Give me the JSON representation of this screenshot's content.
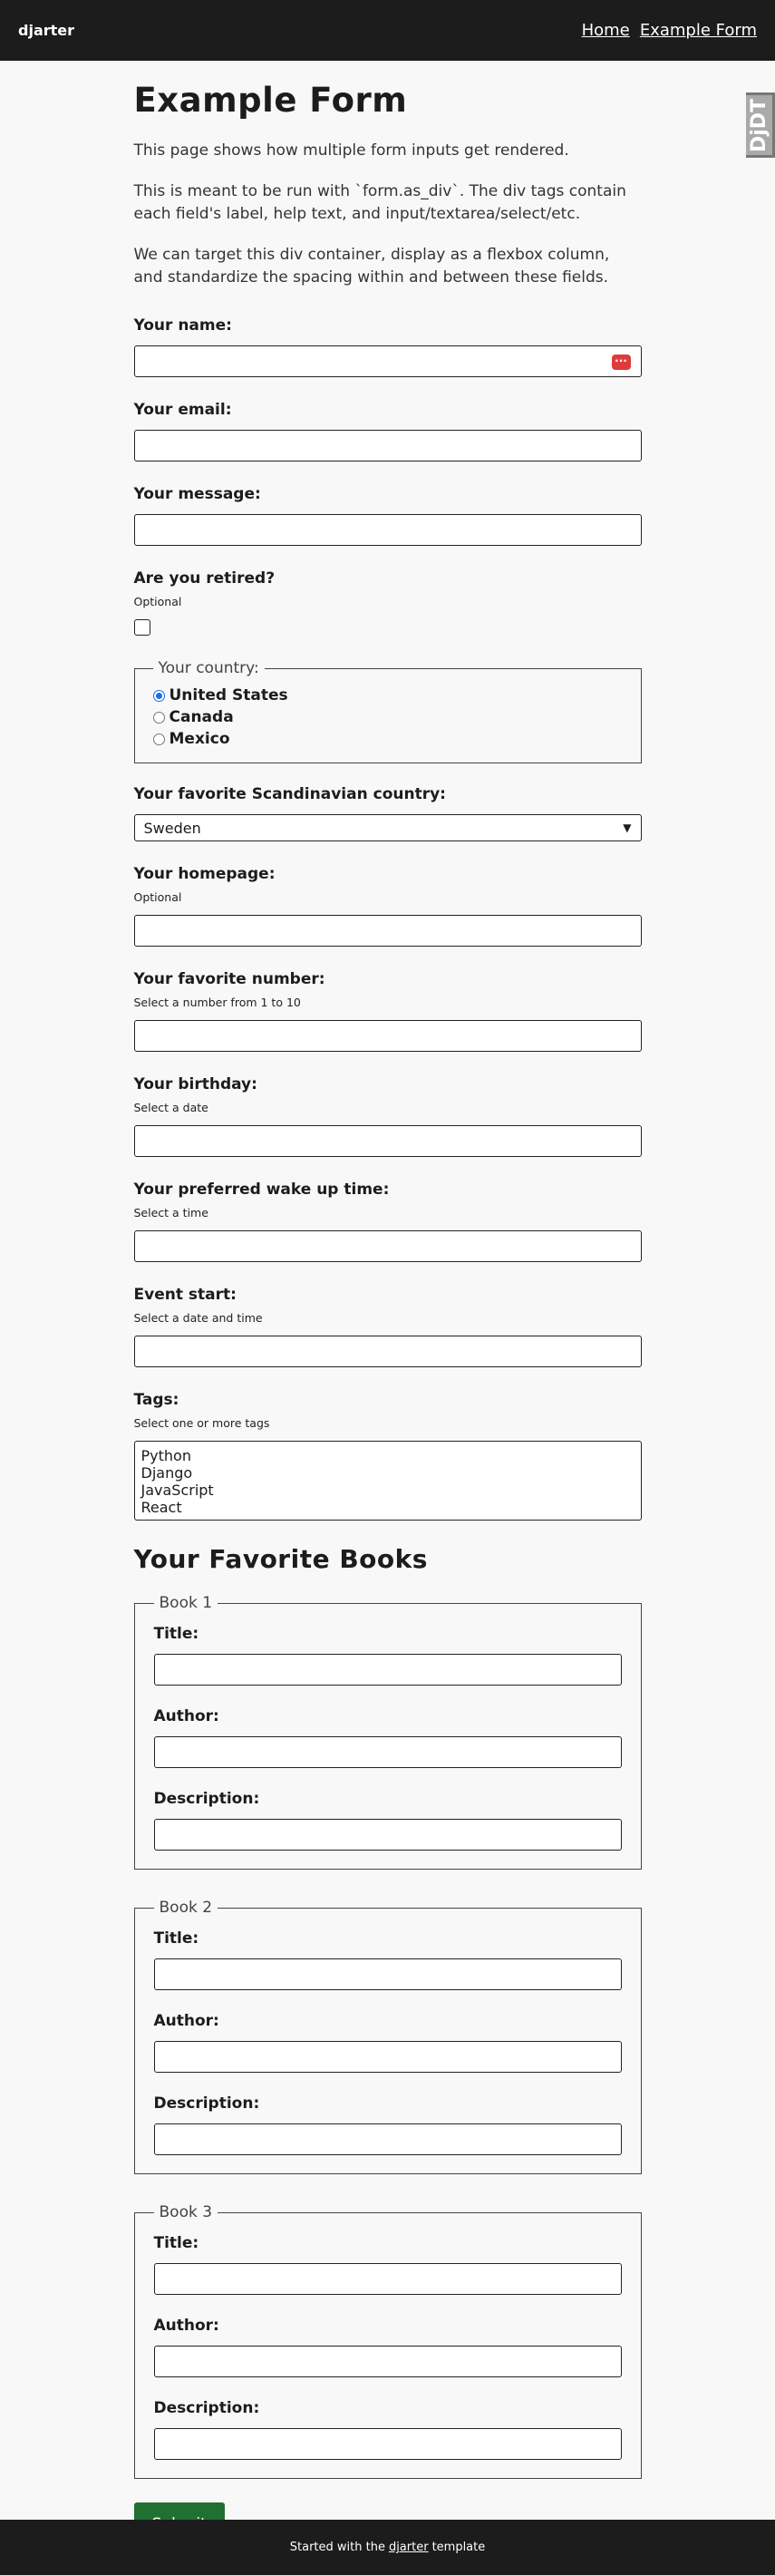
{
  "nav": {
    "brand": "djarter",
    "links": [
      "Home",
      "Example Form"
    ]
  },
  "debug_tab": "DjDT",
  "page": {
    "title": "Example Form",
    "intro": [
      "This page shows how multiple form inputs get rendered.",
      "This is meant to be run with `form.as_div`. The div tags contain each field's label, help text, and input/textarea/select/etc.",
      "We can target this div container, display as a flexbox column, and standardize the spacing within and between these fields."
    ]
  },
  "form": {
    "name_label": "Your name:",
    "email_label": "Your email:",
    "message_label": "Your message:",
    "retired_label": "Are you retired?",
    "retired_help": "Optional",
    "country_legend": "Your country:",
    "countries": [
      "United States",
      "Canada",
      "Mexico"
    ],
    "country_selected": "United States",
    "scandinavian_label": "Your favorite Scandinavian country:",
    "scandinavian_value": "Sweden",
    "homepage_label": "Your homepage:",
    "homepage_help": "Optional",
    "number_label": "Your favorite number:",
    "number_help": "Select a number from 1 to 10",
    "birthday_label": "Your birthday:",
    "birthday_help": "Select a date",
    "wake_label": "Your preferred wake up time:",
    "wake_help": "Select a time",
    "event_label": "Event start:",
    "event_help": "Select a date and time",
    "tags_label": "Tags:",
    "tags_help": "Select one or more tags",
    "tags": [
      "Python",
      "Django",
      "JavaScript",
      "React"
    ]
  },
  "books": {
    "heading": "Your Favorite Books",
    "items": [
      {
        "legend": "Book 1",
        "title_label": "Title:",
        "author_label": "Author:",
        "description_label": "Description:"
      },
      {
        "legend": "Book 2",
        "title_label": "Title:",
        "author_label": "Author:",
        "description_label": "Description:"
      },
      {
        "legend": "Book 3",
        "title_label": "Title:",
        "author_label": "Author:",
        "description_label": "Description:"
      }
    ]
  },
  "submit_label": "Submit",
  "footer": {
    "prefix": "Started with the",
    "link": "djarter",
    "suffix": "template"
  },
  "colors": {
    "nav_bg": "#1c1c1c",
    "submit_bg": "#217033",
    "radio_accent": "#1a6fe0",
    "password_icon": "#e03b3b"
  }
}
